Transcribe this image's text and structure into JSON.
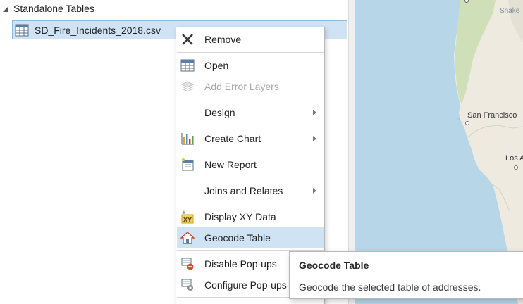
{
  "contents": {
    "group_title": "Standalone Tables",
    "table_name": "SD_Fire_Incidents_2018.csv"
  },
  "map": {
    "labels": {
      "san_francisco": "San Francisco",
      "los_angeles": "Los A",
      "top_right": "Snake"
    },
    "colors": {
      "ocean": "#b7d7e8",
      "land": "#eeeae0",
      "forest": "#cfe0b8"
    }
  },
  "context_menu": {
    "items": [
      {
        "label": "Remove",
        "icon": "remove-x-icon",
        "enabled": true
      },
      {
        "label": "Open",
        "icon": "table-icon",
        "enabled": true
      },
      {
        "label": "Add Error Layers",
        "icon": "layers-icon",
        "enabled": false
      },
      {
        "label": "Design",
        "icon": "",
        "enabled": true,
        "submenu": true
      },
      {
        "label": "Create Chart",
        "icon": "chart-icon",
        "enabled": true,
        "submenu": true
      },
      {
        "label": "New Report",
        "icon": "report-icon",
        "enabled": true
      },
      {
        "label": "Joins and Relates",
        "icon": "",
        "enabled": true,
        "submenu": true
      },
      {
        "label": "Display XY Data",
        "icon": "xy-data-icon",
        "enabled": true
      },
      {
        "label": "Geocode Table",
        "icon": "geocode-house-icon",
        "enabled": true,
        "highlighted": true
      },
      {
        "label": "Disable Pop-ups",
        "icon": "disable-popups-icon",
        "enabled": true
      },
      {
        "label": "Configure Pop-ups",
        "icon": "configure-popups-icon",
        "enabled": true
      }
    ]
  },
  "tooltip": {
    "title": "Geocode Table",
    "description": "Geocode the selected table of addresses."
  },
  "accent_color": "#cfe3f5"
}
